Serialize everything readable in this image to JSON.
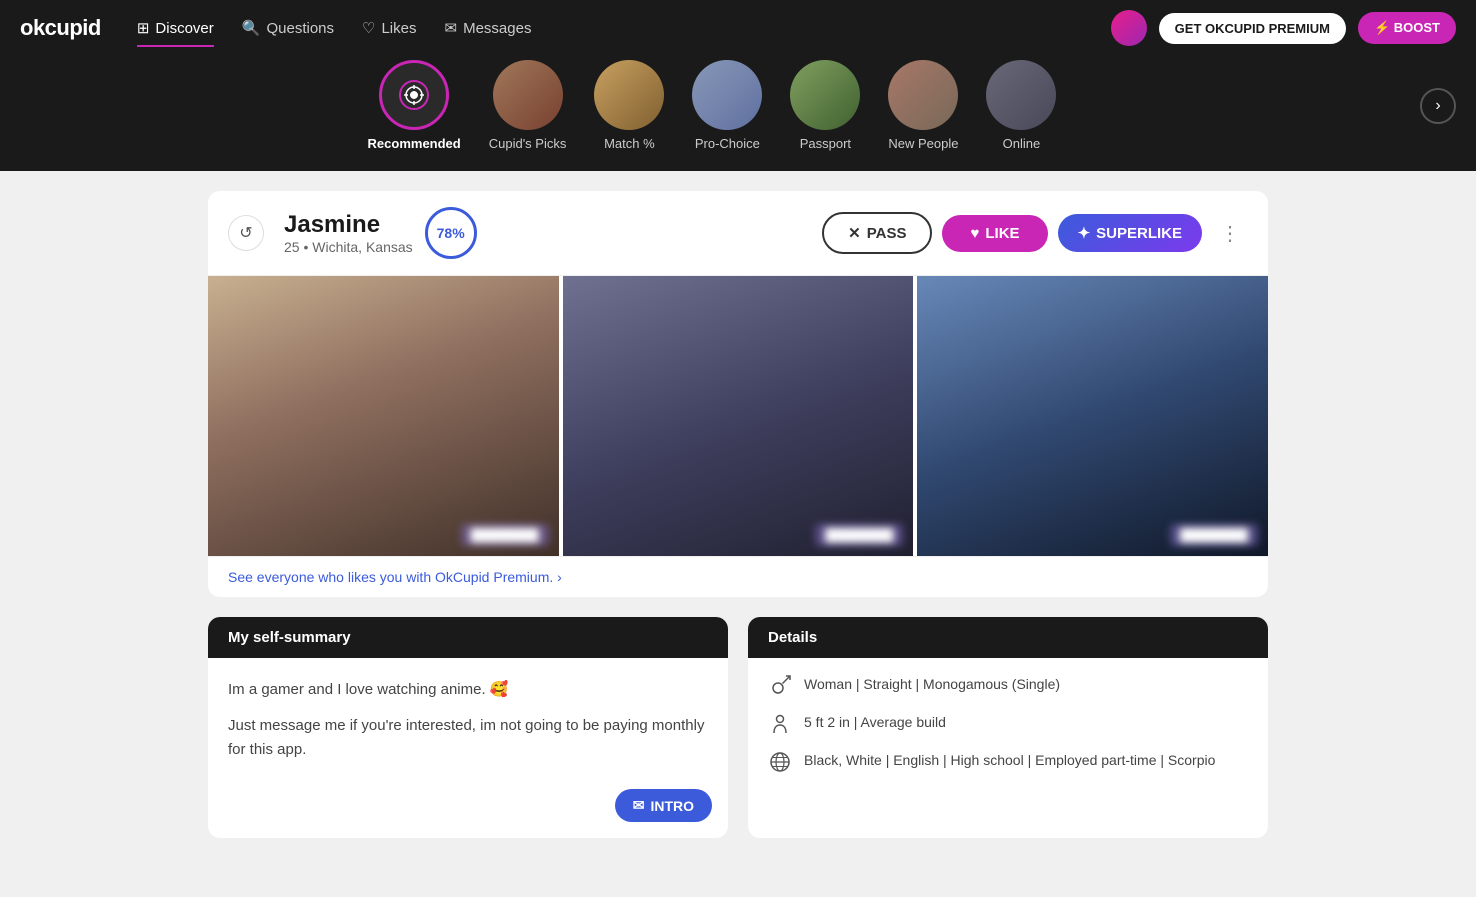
{
  "app": {
    "logo": "okcupid",
    "colors": {
      "brand_pink": "#c926b5",
      "brand_dark": "#1a1a1a",
      "brand_blue": "#3b5bdb",
      "brand_purple": "#7c3aed"
    }
  },
  "nav": {
    "items": [
      {
        "id": "discover",
        "label": "Discover",
        "active": true,
        "icon": "⊞"
      },
      {
        "id": "questions",
        "label": "Questions",
        "active": false,
        "icon": "?"
      },
      {
        "id": "likes",
        "label": "Likes",
        "active": false,
        "icon": "♡"
      },
      {
        "id": "messages",
        "label": "Messages",
        "active": false,
        "icon": "☐"
      }
    ],
    "premium_button": "GET OKCUPID PREMIUM",
    "boost_button": "⚡ BOOST"
  },
  "discover_tabs": {
    "items": [
      {
        "id": "recommended",
        "label": "Recommended",
        "active": true
      },
      {
        "id": "cupids_picks",
        "label": "Cupid's Picks",
        "active": false
      },
      {
        "id": "match",
        "label": "Match %",
        "active": false
      },
      {
        "id": "pro_choice",
        "label": "Pro-Choice",
        "active": false
      },
      {
        "id": "passport",
        "label": "Passport",
        "active": false
      },
      {
        "id": "new_people",
        "label": "New People",
        "active": false
      },
      {
        "id": "online",
        "label": "Online",
        "active": false
      }
    ]
  },
  "profile": {
    "name": "Jasmine",
    "age": "25",
    "location": "Wichita, Kansas",
    "match_percent": "78%",
    "pass_label": "PASS",
    "like_label": "LIKE",
    "superlike_label": "SUPERLIKE",
    "likes_link": "See everyone who likes you with OkCupid Premium. ›",
    "self_summary_header": "My self-summary",
    "self_summary_line1": "Im a gamer and I love watching anime. 🥰",
    "self_summary_line2": "Just message me if you're interested, im not going to be paying monthly for this app.",
    "intro_button": "INTRO",
    "details_header": "Details",
    "details": [
      {
        "icon": "♀",
        "text": "Woman | Straight | Monogamous (Single)"
      },
      {
        "icon": "↕",
        "text": "5 ft 2 in | Average build"
      },
      {
        "icon": "🌐",
        "text": "Black, White | English | High school | Employed part-time | Scorpio"
      }
    ]
  }
}
